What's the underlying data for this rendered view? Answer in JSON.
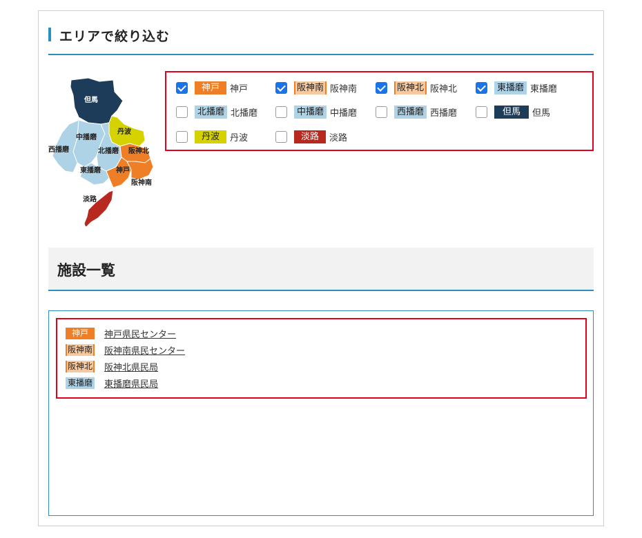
{
  "area_section": {
    "title": "エリアで絞り込む"
  },
  "map": {
    "labels": {
      "tajima": "但馬",
      "tamba": "丹波",
      "nakaharima": "中播磨",
      "nishiharima": "西播磨",
      "kitaharima": "北播磨",
      "hanshinkita": "阪神北",
      "higashiharima": "東播磨",
      "kobe": "神戸",
      "hanshinminami": "阪神南",
      "awaji": "淡路"
    },
    "colors": {
      "tajima": "#1d3c5a",
      "tamba": "#d6d200",
      "harima": "#aed2e6",
      "hanshin_kobe": "#ee7f27",
      "awaji": "#b7291e"
    }
  },
  "filters": [
    {
      "tag": "神戸",
      "label": "神戸",
      "checked": true
    },
    {
      "tag": "阪神南",
      "label": "阪神南",
      "checked": true
    },
    {
      "tag": "阪神北",
      "label": "阪神北",
      "checked": true
    },
    {
      "tag": "東播磨",
      "label": "東播磨",
      "checked": true
    },
    {
      "tag": "北播磨",
      "label": "北播磨",
      "checked": false
    },
    {
      "tag": "中播磨",
      "label": "中播磨",
      "checked": false
    },
    {
      "tag": "西播磨",
      "label": "西播磨",
      "checked": false
    },
    {
      "tag": "但馬",
      "label": "但馬",
      "checked": false
    },
    {
      "tag": "丹波",
      "label": "丹波",
      "checked": false
    },
    {
      "tag": "淡路",
      "label": "淡路",
      "checked": false
    }
  ],
  "facility_section": {
    "title": "施設一覧"
  },
  "facilities": [
    {
      "tag": "神戸",
      "name": "神戸県民センター"
    },
    {
      "tag": "阪神南",
      "name": "阪神南県民センター"
    },
    {
      "tag": "阪神北",
      "name": "阪神北県民局"
    },
    {
      "tag": "東播磨",
      "name": "東播磨県民局"
    }
  ],
  "accent_colors": {
    "heading_bar": "#2a8fbf",
    "highlight_border": "#e3001b",
    "checkbox_checked": "#1a73e8"
  }
}
